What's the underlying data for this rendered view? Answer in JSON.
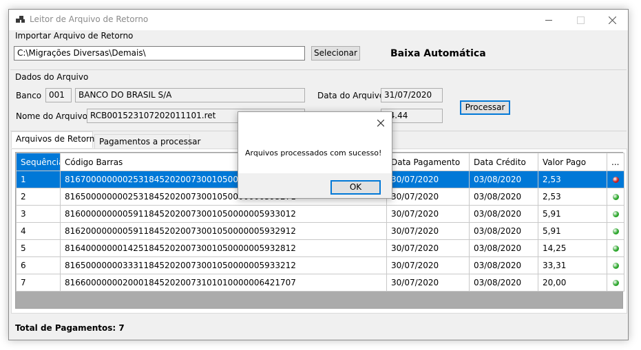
{
  "window": {
    "title": "Leitor de Arquivo de Retorno"
  },
  "import_group": {
    "label": "Importar Arquivo de Retorno",
    "path_value": "C:\\Migrações Diversas\\Demais\\",
    "select_button": "Selecionar",
    "heading": "Baixa Automática"
  },
  "data_group": {
    "label": "Dados do Arquivo",
    "bank_label": "Banco",
    "bank_code": "001",
    "bank_name": "BANCO DO BRASIL  S/A",
    "file_date_label": "Data do Arquivo",
    "file_date": "31/07/2020",
    "file_name_label": "Nome do Arquivo",
    "file_name": "RCB001523107202011101.ret",
    "amount_partial": "84.44",
    "process_button": "Processar"
  },
  "tabs": [
    {
      "label": "Arquivos de Retorno",
      "active": true
    },
    {
      "label": "Pagamentos a processar",
      "active": false
    }
  ],
  "grid": {
    "columns": [
      "Sequência",
      "Código Barras",
      "Data Pagamento",
      "Data Crédito",
      "Valor Pago",
      "..."
    ],
    "rows": [
      {
        "seq": "1",
        "barcode": "81670000000025318452020073001050000000593311",
        "pay_date": "30/07/2020",
        "credit_date": "03/08/2020",
        "amount": "2,53",
        "status": "error",
        "selected": true
      },
      {
        "seq": "2",
        "barcode": "81650000000025318452020073001050000000593271",
        "pay_date": "30/07/2020",
        "credit_date": "03/08/2020",
        "amount": "2,53",
        "status": "ok",
        "selected": false
      },
      {
        "seq": "3",
        "barcode": "81600000000059118452020073001050000005933012",
        "pay_date": "30/07/2020",
        "credit_date": "03/08/2020",
        "amount": "5,91",
        "status": "ok",
        "selected": false
      },
      {
        "seq": "4",
        "barcode": "81620000000059118452020073001050000005932912",
        "pay_date": "30/07/2020",
        "credit_date": "03/08/2020",
        "amount": "5,91",
        "status": "ok",
        "selected": false
      },
      {
        "seq": "5",
        "barcode": "81640000000142518452020073001050000005932812",
        "pay_date": "30/07/2020",
        "credit_date": "03/08/2020",
        "amount": "14,25",
        "status": "ok",
        "selected": false
      },
      {
        "seq": "6",
        "barcode": "81650000000333118452020073001050000005933212",
        "pay_date": "30/07/2020",
        "credit_date": "03/08/2020",
        "amount": "33,31",
        "status": "ok",
        "selected": false
      },
      {
        "seq": "7",
        "barcode": "81660000000200018452020073101010000006421707",
        "pay_date": "30/07/2020",
        "credit_date": "03/08/2020",
        "amount": "20,00",
        "status": "ok",
        "selected": false
      }
    ]
  },
  "footer": {
    "total_label": "Total de Pagamentos: 7"
  },
  "dialog": {
    "message": "Arquivos processados com sucesso!",
    "ok_button": "OK"
  },
  "colors": {
    "accent": "#0078d7",
    "status_ok": "#2aa52a",
    "status_error": "#c81e1e"
  }
}
